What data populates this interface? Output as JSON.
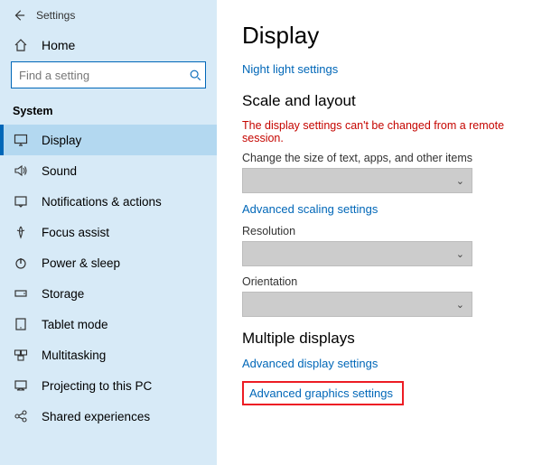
{
  "window": {
    "title": "Settings"
  },
  "sidebar": {
    "home_label": "Home",
    "search_placeholder": "Find a setting",
    "section_label": "System",
    "items": [
      {
        "label": "Display",
        "icon": "display-icon",
        "selected": true
      },
      {
        "label": "Sound",
        "icon": "sound-icon",
        "selected": false
      },
      {
        "label": "Notifications & actions",
        "icon": "notifications-icon",
        "selected": false
      },
      {
        "label": "Focus assist",
        "icon": "focus-assist-icon",
        "selected": false
      },
      {
        "label": "Power & sleep",
        "icon": "power-icon",
        "selected": false
      },
      {
        "label": "Storage",
        "icon": "storage-icon",
        "selected": false
      },
      {
        "label": "Tablet mode",
        "icon": "tablet-icon",
        "selected": false
      },
      {
        "label": "Multitasking",
        "icon": "multitasking-icon",
        "selected": false
      },
      {
        "label": "Projecting to this PC",
        "icon": "projecting-icon",
        "selected": false
      },
      {
        "label": "Shared experiences",
        "icon": "shared-icon",
        "selected": false
      }
    ]
  },
  "main": {
    "title": "Display",
    "night_light_link": "Night light settings",
    "scale_heading": "Scale and layout",
    "error_text": "The display settings can't be changed from a remote session.",
    "scale_label": "Change the size of text, apps, and other items",
    "advanced_scaling_link": "Advanced scaling settings",
    "resolution_label": "Resolution",
    "orientation_label": "Orientation",
    "multiple_heading": "Multiple displays",
    "advanced_display_link": "Advanced display settings",
    "advanced_graphics_link": "Advanced graphics settings"
  }
}
